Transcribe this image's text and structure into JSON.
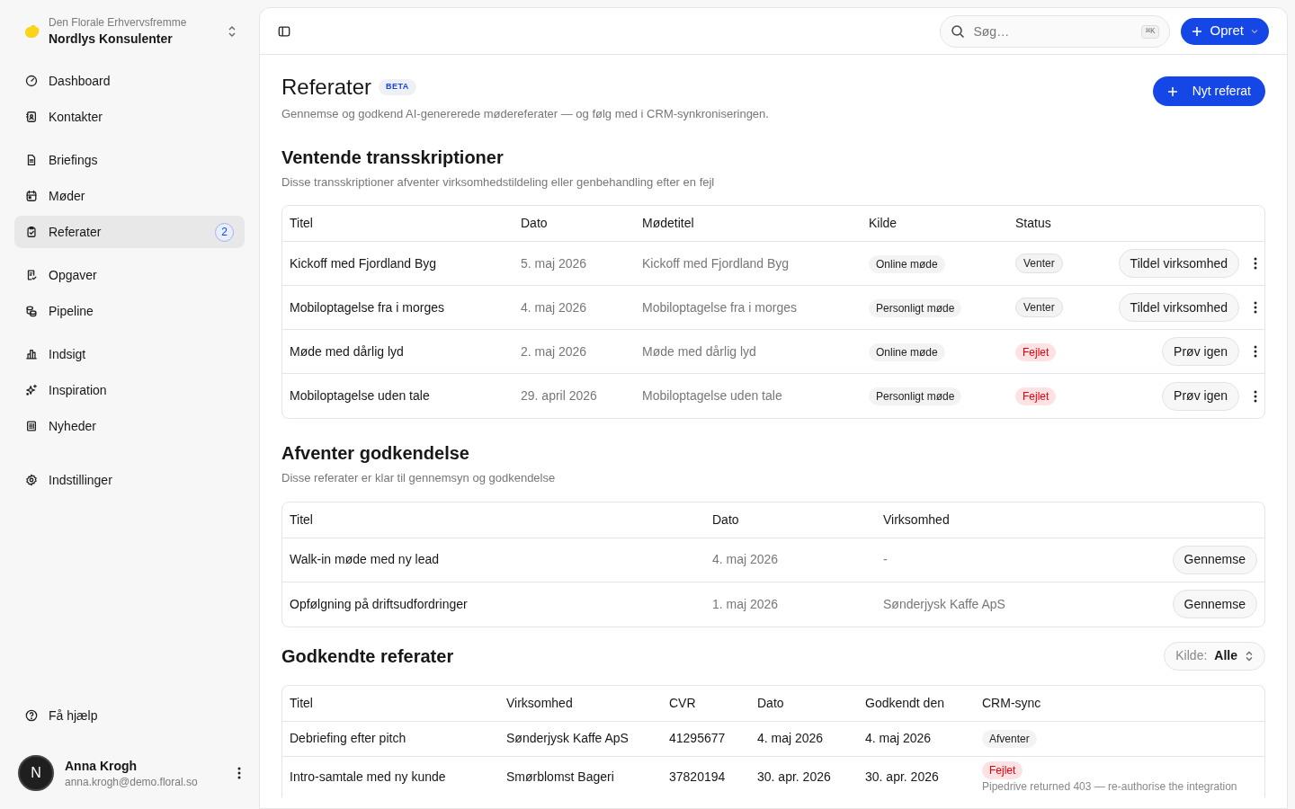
{
  "workspace": {
    "org": "Den Florale Erhvervsfremme",
    "name": "Nordlys Konsulenter"
  },
  "sidebar": {
    "groups": [
      {
        "items": [
          {
            "label": "Dashboard",
            "selected": false
          },
          {
            "label": "Kontakter",
            "selected": false
          }
        ]
      },
      {
        "items": [
          {
            "label": "Briefings",
            "selected": false
          },
          {
            "label": "Møder",
            "selected": false
          },
          {
            "label": "Referater",
            "selected": true,
            "badge": "2"
          }
        ]
      },
      {
        "items": [
          {
            "label": "Opgaver",
            "selected": false
          },
          {
            "label": "Pipeline",
            "selected": false
          }
        ]
      },
      {
        "items": [
          {
            "label": "Indsigt",
            "selected": false
          },
          {
            "label": "Inspiration",
            "selected": false
          },
          {
            "label": "Nyheder",
            "selected": false
          }
        ]
      },
      {
        "items": [
          {
            "label": "Indstillinger",
            "selected": false
          }
        ]
      }
    ],
    "help": "Få hjælp"
  },
  "user": {
    "initial": "N",
    "name": "Anna Krogh",
    "email": "anna.krogh@demo.floral.so"
  },
  "topbar": {
    "search": {
      "placeholder": "Søg…",
      "shortcut": "⌘K"
    },
    "create": "Opret"
  },
  "page": {
    "title": "Referater",
    "badge": "BETA",
    "subtitle": "Gennemse og godkend AI-genererede mødereferater — og følg med i CRM-synkroniseringen.",
    "action": "Nyt referat"
  },
  "pending": {
    "title": "Ventende transskriptioner",
    "subtitle": "Disse transskriptioner afventer virksomhedstildeling eller genbehandling efter en fejl",
    "columns": [
      "Titel",
      "Dato",
      "Mødetitel",
      "Kilde",
      "Status"
    ],
    "rows": [
      {
        "title": "Kickoff med Fjordland Byg",
        "date": "5. maj 2026",
        "meeting": "Kickoff med Fjordland Byg",
        "source": "Online møde",
        "status": {
          "label": "Venter",
          "kind": "waiting"
        },
        "action": "Tildel virksomhed"
      },
      {
        "title": "Mobiloptagelse fra i morges",
        "date": "4. maj 2026",
        "meeting": "Mobiloptagelse fra i morges",
        "source": "Personligt møde",
        "status": {
          "label": "Venter",
          "kind": "waiting"
        },
        "action": "Tildel virksomhed"
      },
      {
        "title": "Møde med dårlig lyd",
        "date": "2. maj 2026",
        "meeting": "Møde med dårlig lyd",
        "source": "Online møde",
        "status": {
          "label": "Fejlet",
          "kind": "failed"
        },
        "action": "Prøv igen"
      },
      {
        "title": "Mobiloptagelse uden tale",
        "date": "29. april 2026",
        "meeting": "Mobiloptagelse uden tale",
        "source": "Personligt møde",
        "status": {
          "label": "Fejlet",
          "kind": "failed"
        },
        "action": "Prøv igen"
      }
    ]
  },
  "review": {
    "title": "Afventer godkendelse",
    "subtitle": "Disse referater er klar til gennemsyn og godkendelse",
    "columns": [
      "Titel",
      "Dato",
      "Virksomhed"
    ],
    "rows": [
      {
        "title": "Walk-in møde med ny lead",
        "date": "4. maj 2026",
        "company": "-",
        "action": "Gennemse"
      },
      {
        "title": "Opfølgning på driftsudfordringer",
        "date": "1. maj 2026",
        "company": "Sønderjysk Kaffe ApS",
        "action": "Gennemse"
      }
    ]
  },
  "approved": {
    "title": "Godkendte referater",
    "filter": {
      "label": "Kilde:",
      "value": "Alle"
    },
    "columns": [
      "Titel",
      "Virksomhed",
      "CVR",
      "Dato",
      "Godkendt den",
      "CRM-sync"
    ],
    "rows": [
      {
        "title": "Debriefing efter pitch",
        "company": "Sønderjysk Kaffe ApS",
        "cvr": "41295677",
        "date": "4. maj 2026",
        "approved": "4. maj 2026",
        "sync": {
          "label": "Afventer",
          "kind": "waiting"
        }
      },
      {
        "title": "Intro-samtale med ny kunde",
        "company": "Smørblomst Bageri",
        "cvr": "37820194",
        "date": "30. apr. 2026",
        "approved": "30. apr. 2026",
        "sync": {
          "label": "Fejlet",
          "kind": "failed",
          "note": "Pipedrive returned 403 — re-authorise the integration"
        }
      }
    ]
  }
}
